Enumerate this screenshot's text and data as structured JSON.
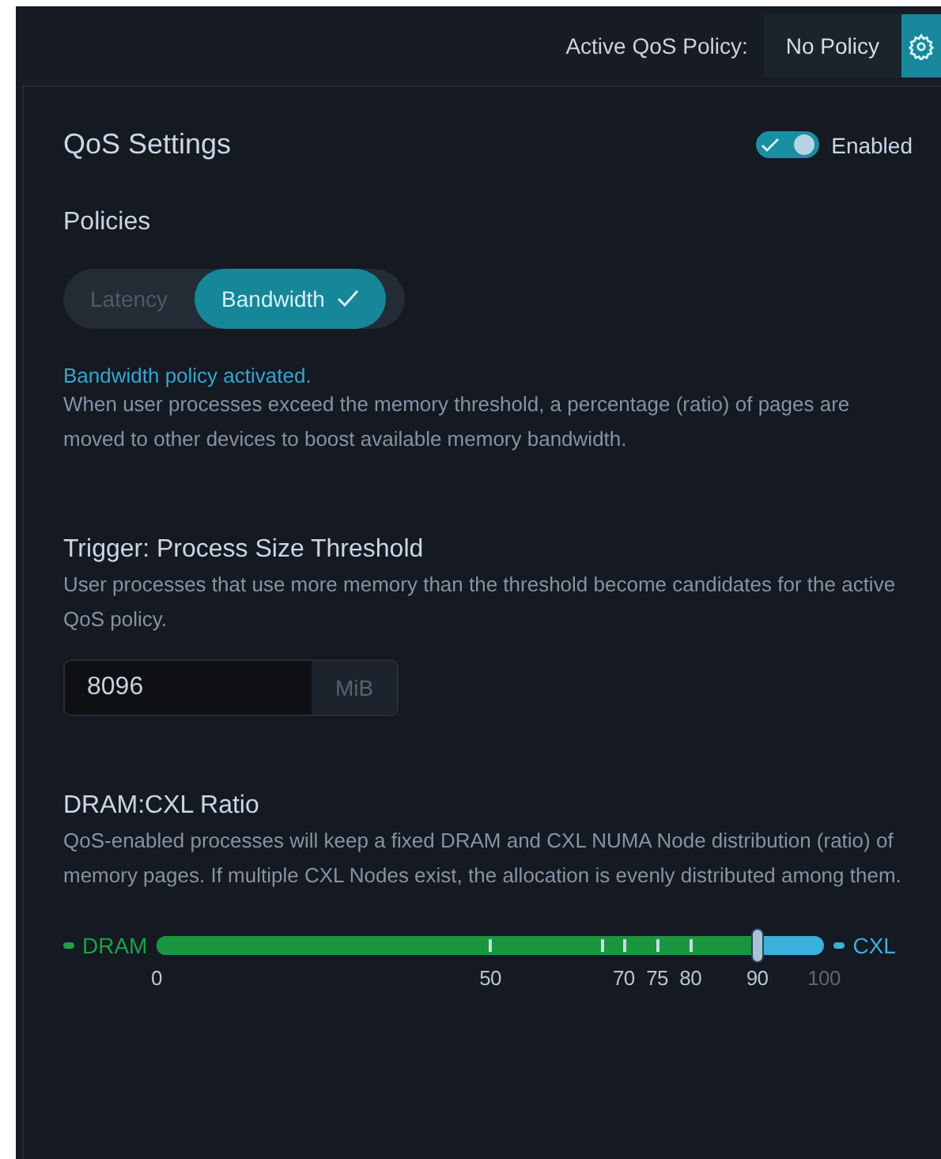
{
  "header": {
    "label": "Active QoS Policy:",
    "policy": "No Policy"
  },
  "settings": {
    "title": "QoS Settings",
    "toggle": {
      "label": "Enabled",
      "on": true
    }
  },
  "policies": {
    "title": "Policies",
    "options": [
      {
        "label": "Latency",
        "selected": false
      },
      {
        "label": "Bandwidth",
        "selected": true
      }
    ],
    "status": "Bandwidth policy activated.",
    "description": "When user processes exceed the memory threshold, a percentage (ratio) of pages are moved to other devices to boost available memory bandwidth."
  },
  "threshold": {
    "title": "Trigger: Process Size Threshold",
    "description": "User processes that use more memory than the threshold become candidates for the active QoS policy.",
    "value": "8096",
    "unit": "MiB"
  },
  "ratio": {
    "title": "DRAM:CXL Ratio",
    "description": "QoS-enabled processes will keep a fixed DRAM and CXL NUMA Node distribution (ratio) of memory pages. If multiple CXL Nodes exist, the allocation is evenly distributed among them.",
    "left_label": "DRAM",
    "right_label": "CXL",
    "level": 0.9,
    "scale_labels": [
      "0",
      "50",
      "70",
      "75",
      "80",
      "90",
      "100"
    ]
  }
}
